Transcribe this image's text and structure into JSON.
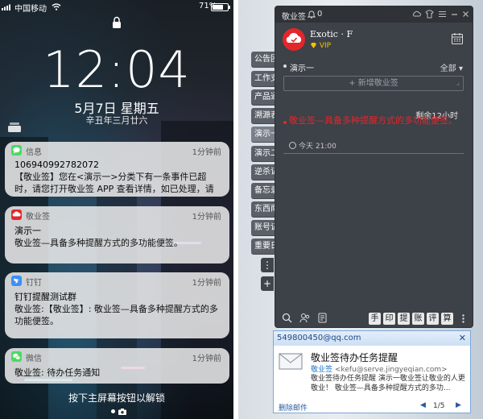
{
  "phone": {
    "carrier": "中国移动",
    "battery_pct": "71%",
    "battery_level": 0.71,
    "time": "12:04",
    "date": "5月7日 星期五",
    "lunar": "辛丑年三月廿六",
    "unlock_hint": "按下主屏幕按钮以解锁",
    "notifications": [
      {
        "app": "信息",
        "time": "1分钟前",
        "title": "106940992782072",
        "body": "【敬业签】您在<演示一>分类下有一条事件已超时，请您打开敬业签 APP 查看详情，如已处理，请忽略",
        "icon_color": "#4cd964"
      },
      {
        "app": "敬业签",
        "time": "1分钟前",
        "title": "演示一",
        "body": "敬业签—具备多种提醒方式的多功能便签。",
        "icon_color": "#e4262b"
      },
      {
        "app": "钉钉",
        "time": "1分钟前",
        "title": "钉钉提醒测试群",
        "body": "敬业签:【敬业签】: 敬业签—具备多种提醒方式的多功能便签。",
        "icon_color": "#3b8ff5"
      },
      {
        "app": "微信",
        "time": "1分钟前",
        "title": "",
        "body": "敬业签: 待办任务通知",
        "icon_color": "#4cd964"
      }
    ]
  },
  "desktop": {
    "side_tabs": [
      "公告团",
      "工作支",
      "产品通",
      "溯源表",
      "演示一",
      "演示二",
      "逆杀记",
      "备忘录",
      "东西南",
      "账号记",
      "重要日"
    ],
    "side_buttons": [
      "⋮",
      "+"
    ],
    "app": {
      "title": "敬业签",
      "bell_count": "0",
      "user_name": "Exotic · F",
      "vip": "VIP",
      "category": "演示一",
      "filter": "全部",
      "new_note_placeholder": "+ 新增敬业签",
      "remaining": "剩余12小时",
      "note_text": "敬业签—具备多种提醒方式的多功能便签。",
      "note_time": "今天  21:00",
      "toolbar_keys": [
        "手",
        "印",
        "提",
        "账",
        "评",
        "算"
      ]
    },
    "mail": {
      "address": "549800450@qq.com",
      "subject": "敬业签待办任务提醒",
      "sender_name": "敬业签",
      "sender_email": "<kefu@serve.jingyeqian.com>",
      "preview": "敬业签待办任务提醒 演示一敬业签让敬业的人更敬业！ 敬业签—具备多种提醒方式的多功...",
      "delete_label": "删除邮件",
      "page": "1/5"
    },
    "colors": {
      "brand_red": "#e4262b",
      "vip_gold": "#f2c200",
      "panel_dark": "#3d4148"
    }
  }
}
